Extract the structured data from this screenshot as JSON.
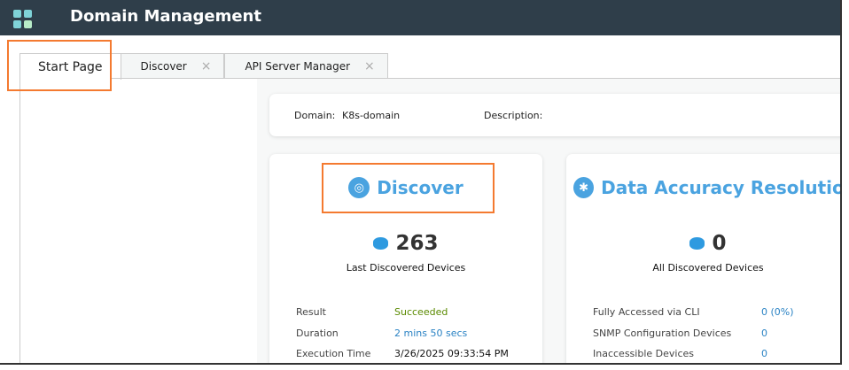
{
  "header": {
    "title": "Domain Management",
    "icon": "apps-grid-icon"
  },
  "tabs": [
    {
      "label": "Start Page",
      "active": true
    },
    {
      "label": "Discover",
      "close": "×"
    },
    {
      "label": "API Server Manager",
      "close": "×"
    }
  ],
  "domain": {
    "domain_label": "Domain:",
    "domain_value": "K8s-domain",
    "description_label": "Description:"
  },
  "discover": {
    "title": "Discover",
    "count": "263",
    "count_label": "Last Discovered Devices",
    "rows": [
      {
        "label": "Result",
        "value": "Succeeded",
        "color": "#5a8a00"
      },
      {
        "label": "Duration",
        "value": "2 mins 50 secs",
        "color": "#2b83c4"
      },
      {
        "label": "Execution Time",
        "value": "3/26/2025 09:33:54 PM",
        "color": "#111"
      }
    ]
  },
  "dar": {
    "title": "Data Accuracy Resolution",
    "count": "0",
    "count_label": "All Discovered Devices",
    "rows": [
      {
        "label": "Fully Accessed via CLI",
        "value": "0 (0%)"
      },
      {
        "label": "SNMP Configuration Devices",
        "value": "0"
      },
      {
        "label": "Inaccessible Devices",
        "value": "0"
      }
    ]
  },
  "colors": {
    "accent": "#4aa3e0",
    "header": "#2f3e4a",
    "highlight": "#f47a30"
  }
}
